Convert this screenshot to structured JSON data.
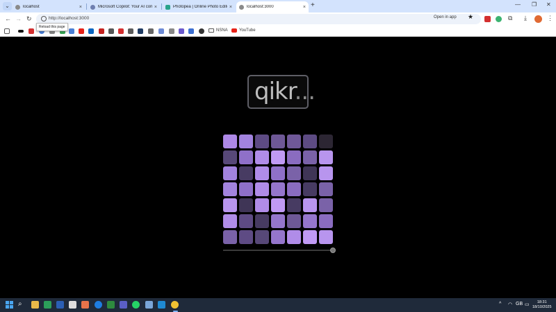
{
  "browser": {
    "tabs": [
      {
        "label": "localhost",
        "active": false
      },
      {
        "label": "Microsoft Copilot: Your AI compan",
        "active": false
      },
      {
        "label": "Photopea | Online Photo Editor",
        "active": false
      },
      {
        "label": "localhost:3000",
        "active": true
      }
    ],
    "new_tab_label": "+",
    "address": "http://localhost:3000",
    "tooltip": "Reload this page",
    "open_in_app_label": "Open in app",
    "bookmarks": {
      "folders": [
        "NSNA",
        "YouTube"
      ]
    }
  },
  "page": {
    "logo": {
      "main": "qikr",
      "suffix": "..."
    },
    "grid": {
      "rows": 7,
      "cols": 7,
      "cells": [
        [
          "#ad88e6",
          "#a283de",
          "#5e4b84",
          "#6e5896",
          "#6f5898",
          "#5d4b83",
          "#2c2633"
        ],
        [
          "#574878",
          "#8f70c8",
          "#b08ce8",
          "#c09af4",
          "#8a6cc0",
          "#7a62a8",
          "#b895ee"
        ],
        [
          "#a283de",
          "#473b62",
          "#b08ce8",
          "#8f70c8",
          "#7a62a8",
          "#3f3556",
          "#b895ee"
        ],
        [
          "#a283de",
          "#8f70c8",
          "#b08ce8",
          "#9576cc",
          "#8a6cc0",
          "#473b62",
          "#7a62a8"
        ],
        [
          "#b895ee",
          "#3f3556",
          "#b08ce8",
          "#c09af4",
          "#473b62",
          "#b895ee",
          "#7a62a8"
        ],
        [
          "#b08ce8",
          "#5e4b84",
          "#473b62",
          "#9576cc",
          "#6e5896",
          "#9576cc",
          "#8a6cc0"
        ],
        [
          "#7a62a8",
          "#5e4b84",
          "#574878",
          "#9576cc",
          "#b08ce8",
          "#c09af4",
          "#b895ee"
        ]
      ]
    },
    "slider": {
      "value": 1.0
    }
  },
  "taskbar": {
    "clock_time": "18:31",
    "clock_date": "18/10/2025",
    "lang": "GB"
  }
}
